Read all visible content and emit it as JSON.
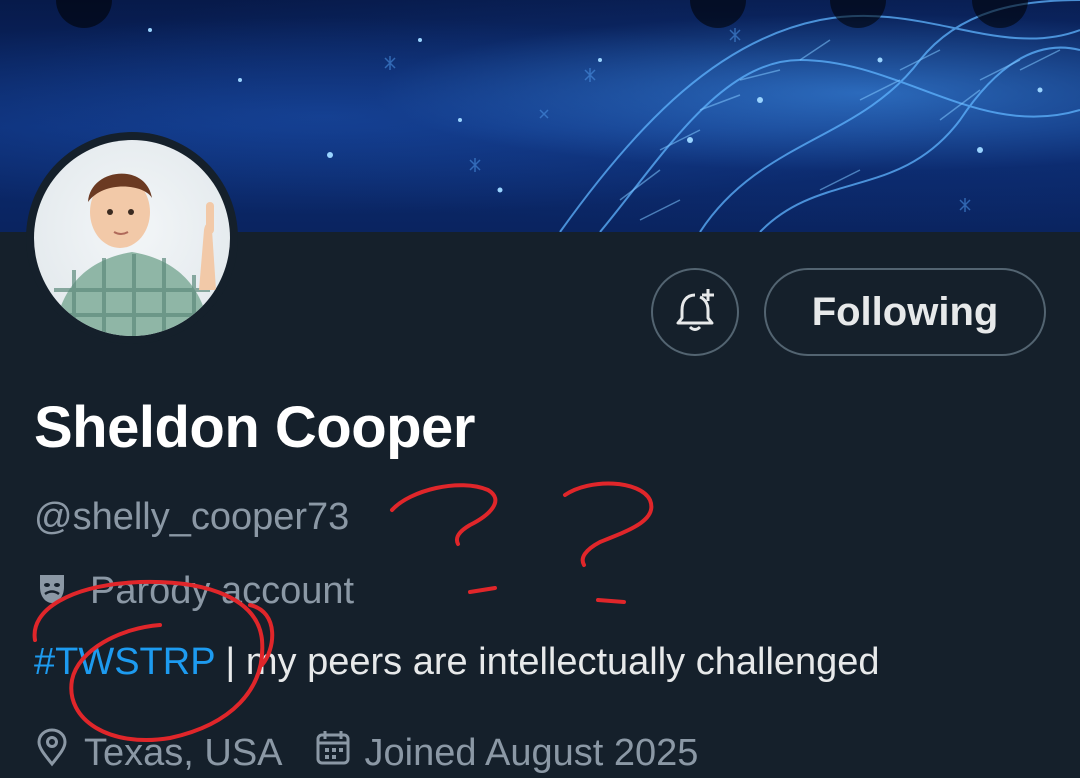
{
  "profile": {
    "display_name": "Sheldon Cooper",
    "handle": "@shelly_cooper73",
    "parody_label": "Parody account",
    "bio_hashtag": "#TWSTRP",
    "bio_separator": " | ",
    "bio_text": "my peers are intellectually challenged",
    "location": "Texas, USA",
    "joined": "Joined August 2025"
  },
  "actions": {
    "following_label": "Following"
  },
  "icons": {
    "notify": "bell-plus-icon",
    "parody": "theater-masks-icon",
    "location": "map-pin-icon",
    "joined": "calendar-icon"
  },
  "colors": {
    "background": "#15202b",
    "text_primary": "#e7e9ea",
    "text_secondary": "#8b98a5",
    "link": "#1d9bf0",
    "border": "#536471",
    "annotation": "#e0262a"
  }
}
